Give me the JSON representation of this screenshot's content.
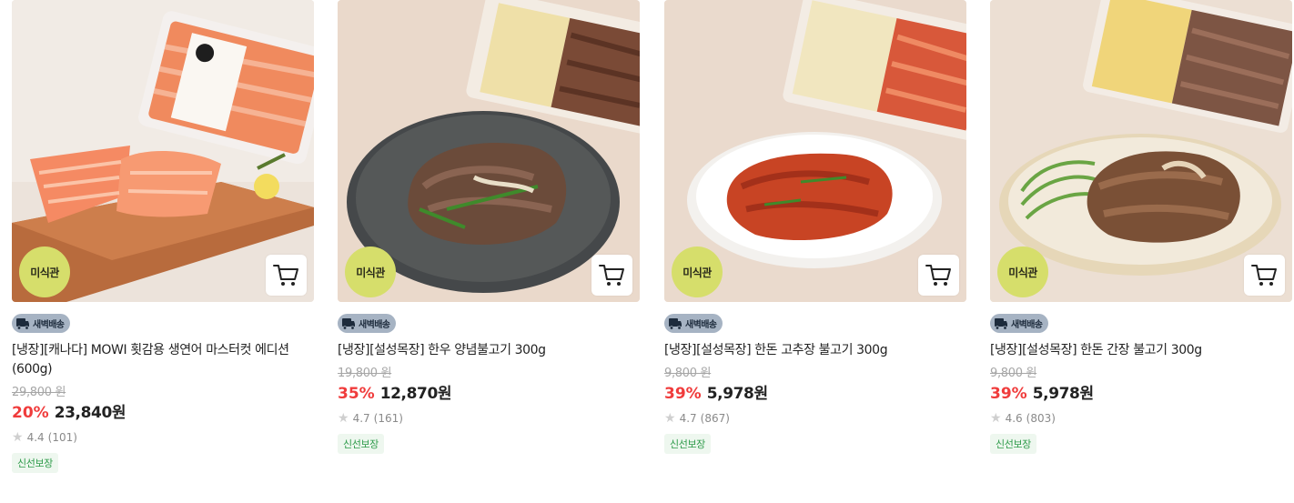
{
  "products": [
    {
      "badge": "미식관",
      "delivery": "새벽배송",
      "name": "[냉장][캐나다] MOWI 횟감용 생연어 마스터컷 에디션 (600g)",
      "original_price": "29,800 원",
      "discount": "20%",
      "price": "23,840원",
      "rating": "4.4",
      "reviews": "(101)",
      "tag": "신선보장"
    },
    {
      "badge": "미식관",
      "delivery": "새벽배송",
      "name": "[냉장][설성목장] 한우 양념불고기 300g",
      "original_price": "19,800 원",
      "discount": "35%",
      "price": "12,870원",
      "rating": "4.7",
      "reviews": "(161)",
      "tag": "신선보장"
    },
    {
      "badge": "미식관",
      "delivery": "새벽배송",
      "name": "[냉장][설성목장] 한돈 고추장 불고기 300g",
      "original_price": "9,800 원",
      "discount": "39%",
      "price": "5,978원",
      "rating": "4.7",
      "reviews": "(867)",
      "tag": "신선보장"
    },
    {
      "badge": "미식관",
      "delivery": "새벽배송",
      "name": "[냉장][설성목장] 한돈 간장 불고기 300g",
      "original_price": "9,800 원",
      "discount": "39%",
      "price": "5,978원",
      "rating": "4.6",
      "reviews": "(803)",
      "tag": "신선보장"
    }
  ],
  "colors": {
    "badge_bg": "#d6de6b",
    "discount": "#f03c3c",
    "delivery_bg": "#a6b3c3",
    "fresh_text": "#2e9b4a"
  }
}
